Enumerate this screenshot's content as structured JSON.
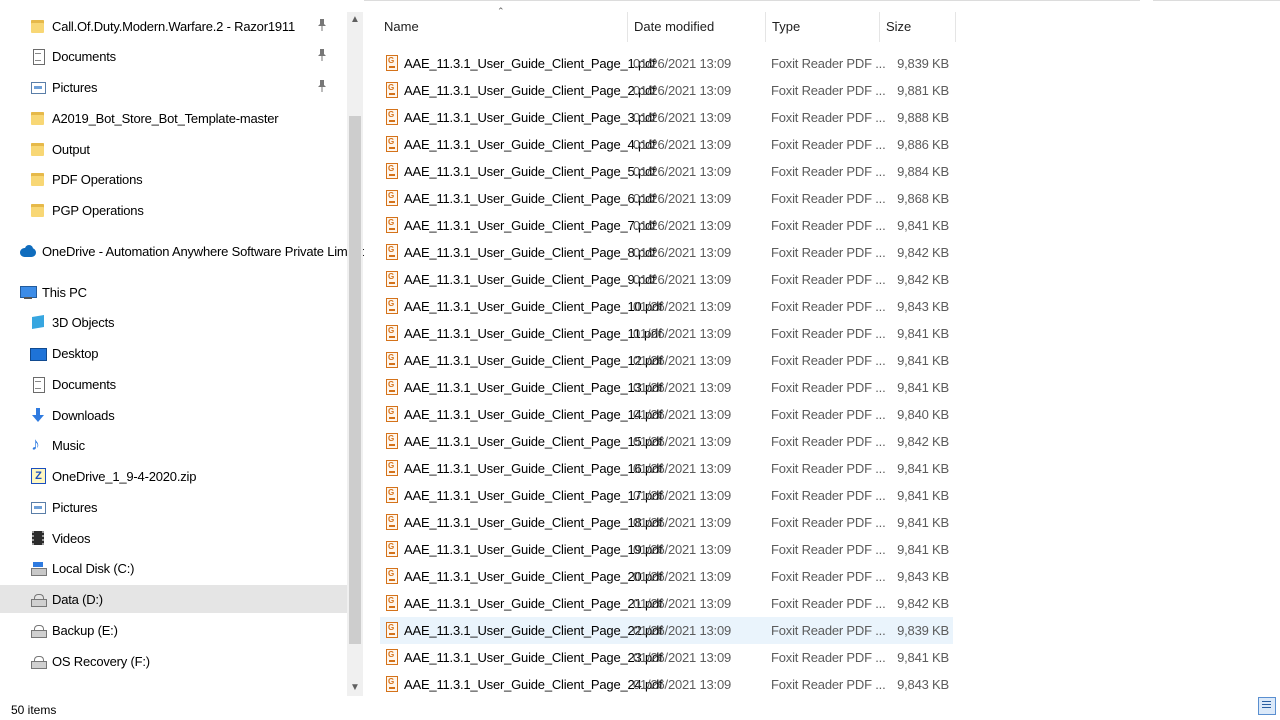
{
  "nav": {
    "items": [
      {
        "label": "Call.Of.Duty.Modern.Warfare.2 - Razor1911",
        "icon": "folder-icon",
        "pinned": true
      },
      {
        "label": "Documents",
        "icon": "documents-icon",
        "pinned": true
      },
      {
        "label": "Pictures",
        "icon": "pictures-icon",
        "pinned": true
      },
      {
        "label": "A2019_Bot_Store_Bot_Template-master",
        "icon": "folder-icon",
        "pinned": false
      },
      {
        "label": "Output",
        "icon": "folder-icon",
        "pinned": false
      },
      {
        "label": "PDF Operations",
        "icon": "folder-icon",
        "pinned": false
      },
      {
        "label": "PGP Operations",
        "icon": "folder-icon",
        "pinned": false
      },
      {
        "label": "OneDrive - Automation Anywhere Software Private Limited",
        "icon": "onedrive-icon",
        "pinned": false
      },
      {
        "label": "This PC",
        "icon": "this-pc-icon",
        "pinned": false
      },
      {
        "label": "3D Objects",
        "icon": "3d-objects-icon",
        "pinned": false
      },
      {
        "label": "Desktop",
        "icon": "desktop-icon",
        "pinned": false
      },
      {
        "label": "Documents",
        "icon": "documents-icon",
        "pinned": false
      },
      {
        "label": "Downloads",
        "icon": "downloads-icon",
        "pinned": false
      },
      {
        "label": "Music",
        "icon": "music-icon",
        "pinned": false
      },
      {
        "label": "OneDrive_1_9-4-2020.zip",
        "icon": "zip-icon",
        "pinned": false
      },
      {
        "label": "Pictures",
        "icon": "pictures-icon",
        "pinned": false
      },
      {
        "label": "Videos",
        "icon": "videos-icon",
        "pinned": false
      },
      {
        "label": "Local Disk (C:)",
        "icon": "local-disk-icon",
        "pinned": false
      },
      {
        "label": "Data (D:)",
        "icon": "drive-icon",
        "pinned": false,
        "selected": true
      },
      {
        "label": "Backup (E:)",
        "icon": "drive-icon",
        "pinned": false
      },
      {
        "label": "OS Recovery (F:)",
        "icon": "drive-icon",
        "pinned": false
      }
    ]
  },
  "columns": {
    "name": "Name",
    "date": "Date modified",
    "type": "Type",
    "size": "Size"
  },
  "files": [
    {
      "name": "AAE_11.3.1_User_Guide_Client_Page_1.pdf",
      "date": "01/26/2021 13:09",
      "type": "Foxit Reader PDF ...",
      "size": "9,839 KB"
    },
    {
      "name": "AAE_11.3.1_User_Guide_Client_Page_2.pdf",
      "date": "01/26/2021 13:09",
      "type": "Foxit Reader PDF ...",
      "size": "9,881 KB"
    },
    {
      "name": "AAE_11.3.1_User_Guide_Client_Page_3.pdf",
      "date": "01/26/2021 13:09",
      "type": "Foxit Reader PDF ...",
      "size": "9,888 KB"
    },
    {
      "name": "AAE_11.3.1_User_Guide_Client_Page_4.pdf",
      "date": "01/26/2021 13:09",
      "type": "Foxit Reader PDF ...",
      "size": "9,886 KB"
    },
    {
      "name": "AAE_11.3.1_User_Guide_Client_Page_5.pdf",
      "date": "01/26/2021 13:09",
      "type": "Foxit Reader PDF ...",
      "size": "9,884 KB"
    },
    {
      "name": "AAE_11.3.1_User_Guide_Client_Page_6.pdf",
      "date": "01/26/2021 13:09",
      "type": "Foxit Reader PDF ...",
      "size": "9,868 KB"
    },
    {
      "name": "AAE_11.3.1_User_Guide_Client_Page_7.pdf",
      "date": "01/26/2021 13:09",
      "type": "Foxit Reader PDF ...",
      "size": "9,841 KB"
    },
    {
      "name": "AAE_11.3.1_User_Guide_Client_Page_8.pdf",
      "date": "01/26/2021 13:09",
      "type": "Foxit Reader PDF ...",
      "size": "9,842 KB"
    },
    {
      "name": "AAE_11.3.1_User_Guide_Client_Page_9.pdf",
      "date": "01/26/2021 13:09",
      "type": "Foxit Reader PDF ...",
      "size": "9,842 KB"
    },
    {
      "name": "AAE_11.3.1_User_Guide_Client_Page_10.pdf",
      "date": "01/26/2021 13:09",
      "type": "Foxit Reader PDF ...",
      "size": "9,843 KB"
    },
    {
      "name": "AAE_11.3.1_User_Guide_Client_Page_11.pdf",
      "date": "01/26/2021 13:09",
      "type": "Foxit Reader PDF ...",
      "size": "9,841 KB"
    },
    {
      "name": "AAE_11.3.1_User_Guide_Client_Page_12.pdf",
      "date": "01/26/2021 13:09",
      "type": "Foxit Reader PDF ...",
      "size": "9,841 KB"
    },
    {
      "name": "AAE_11.3.1_User_Guide_Client_Page_13.pdf",
      "date": "01/26/2021 13:09",
      "type": "Foxit Reader PDF ...",
      "size": "9,841 KB"
    },
    {
      "name": "AAE_11.3.1_User_Guide_Client_Page_14.pdf",
      "date": "01/26/2021 13:09",
      "type": "Foxit Reader PDF ...",
      "size": "9,840 KB"
    },
    {
      "name": "AAE_11.3.1_User_Guide_Client_Page_15.pdf",
      "date": "01/26/2021 13:09",
      "type": "Foxit Reader PDF ...",
      "size": "9,842 KB"
    },
    {
      "name": "AAE_11.3.1_User_Guide_Client_Page_16.pdf",
      "date": "01/26/2021 13:09",
      "type": "Foxit Reader PDF ...",
      "size": "9,841 KB"
    },
    {
      "name": "AAE_11.3.1_User_Guide_Client_Page_17.pdf",
      "date": "01/26/2021 13:09",
      "type": "Foxit Reader PDF ...",
      "size": "9,841 KB"
    },
    {
      "name": "AAE_11.3.1_User_Guide_Client_Page_18.pdf",
      "date": "01/26/2021 13:09",
      "type": "Foxit Reader PDF ...",
      "size": "9,841 KB"
    },
    {
      "name": "AAE_11.3.1_User_Guide_Client_Page_19.pdf",
      "date": "01/26/2021 13:09",
      "type": "Foxit Reader PDF ...",
      "size": "9,841 KB"
    },
    {
      "name": "AAE_11.3.1_User_Guide_Client_Page_20.pdf",
      "date": "01/26/2021 13:09",
      "type": "Foxit Reader PDF ...",
      "size": "9,843 KB"
    },
    {
      "name": "AAE_11.3.1_User_Guide_Client_Page_21.pdf",
      "date": "01/26/2021 13:09",
      "type": "Foxit Reader PDF ...",
      "size": "9,842 KB"
    },
    {
      "name": "AAE_11.3.1_User_Guide_Client_Page_22.pdf",
      "date": "01/26/2021 13:09",
      "type": "Foxit Reader PDF ...",
      "size": "9,839 KB",
      "selected": true
    },
    {
      "name": "AAE_11.3.1_User_Guide_Client_Page_23.pdf",
      "date": "01/26/2021 13:09",
      "type": "Foxit Reader PDF ...",
      "size": "9,841 KB"
    },
    {
      "name": "AAE_11.3.1_User_Guide_Client_Page_24.pdf",
      "date": "01/26/2021 13:09",
      "type": "Foxit Reader PDF ...",
      "size": "9,843 KB"
    }
  ],
  "status": {
    "item_count": "50 items"
  },
  "colors": {
    "selected_row": "#eaf4fc",
    "selected_nav": "#e5e5e5",
    "pdf_accent": "#d4721a"
  }
}
